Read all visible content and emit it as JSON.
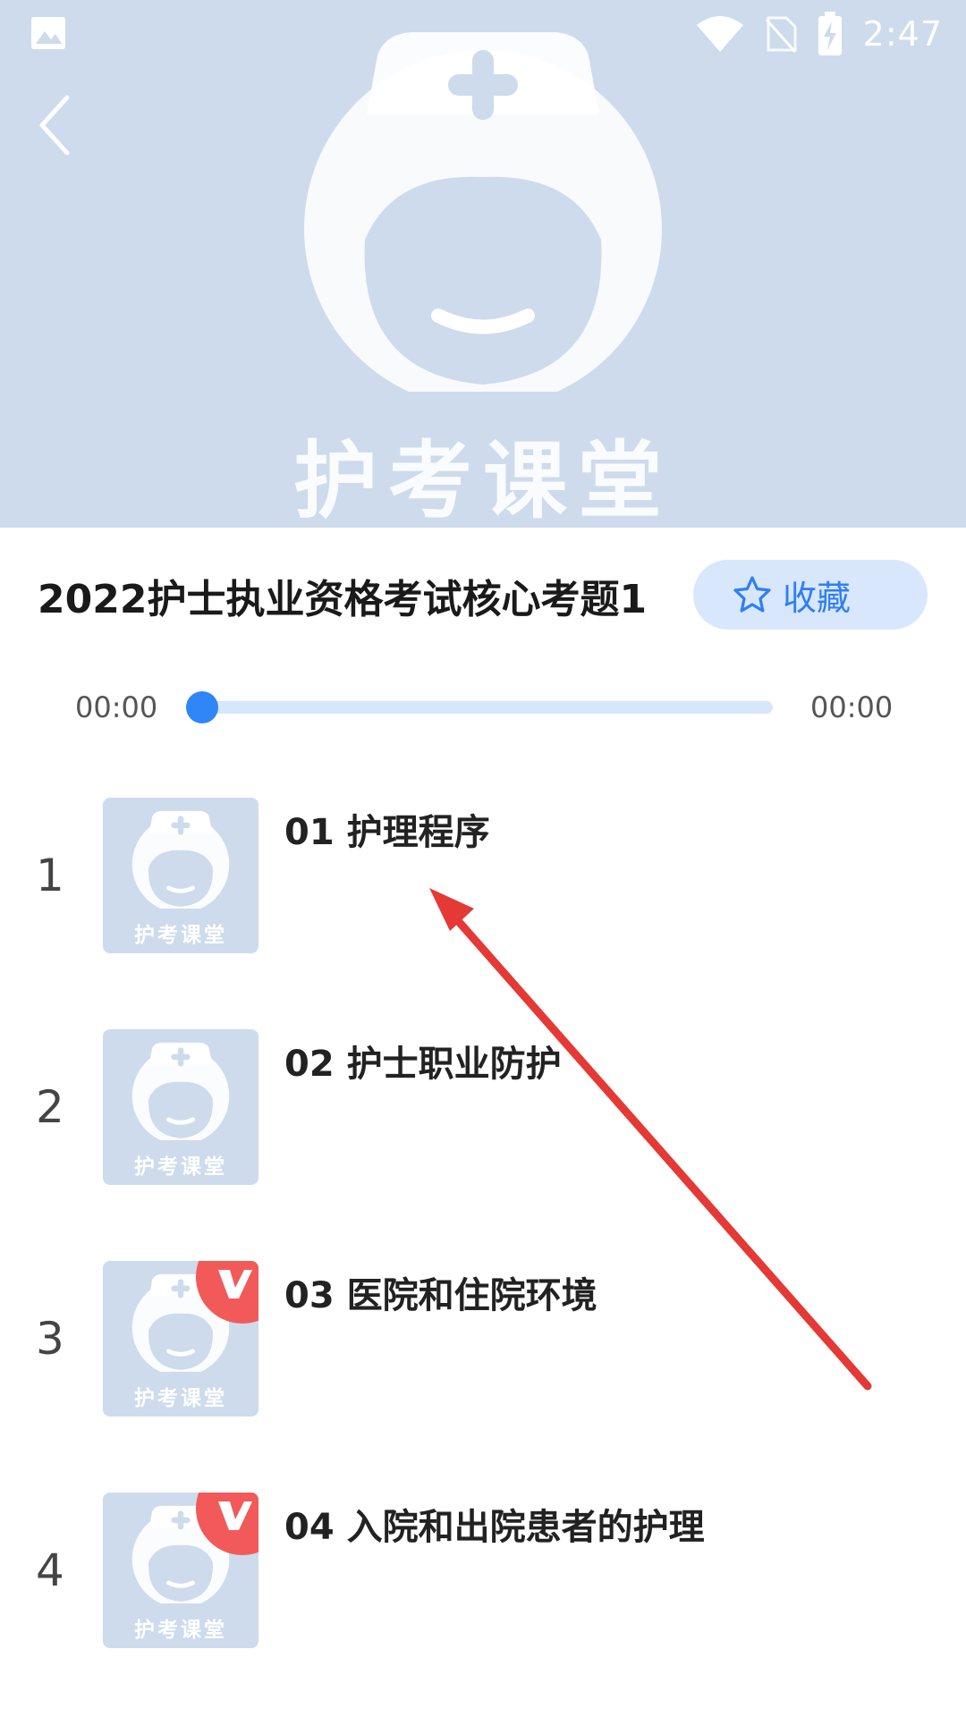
{
  "status_bar": {
    "time": "2:47",
    "icons": [
      "image-icon",
      "wifi-icon",
      "no-sim-icon",
      "battery-charging-icon"
    ]
  },
  "header": {
    "back_icon": "chevron-left-icon",
    "brand": "护考课堂"
  },
  "course": {
    "title": "2022护士执业资格考试核心考题1",
    "favorite_label": "收藏",
    "favorite_icon": "star-outline-icon"
  },
  "player": {
    "current_time": "00:00",
    "total_time": "00:00",
    "progress": 0
  },
  "lessons": [
    {
      "index": "1",
      "title": "01 护理程序",
      "thumb_brand": "护考课堂",
      "vip": false
    },
    {
      "index": "2",
      "title": "02 护士职业防护",
      "thumb_brand": "护考课堂",
      "vip": false
    },
    {
      "index": "3",
      "title": "03 医院和住院环境",
      "thumb_brand": "护考课堂",
      "vip": true
    },
    {
      "index": "4",
      "title": "04 入院和出院患者的护理",
      "thumb_brand": "护考课堂",
      "vip": true
    }
  ],
  "colors": {
    "header_bg": "#cddbec",
    "accent": "#2f86f6",
    "favorite_bg": "#d8e7fb",
    "vip": "#f25a5a",
    "annotation": "#e53935"
  }
}
